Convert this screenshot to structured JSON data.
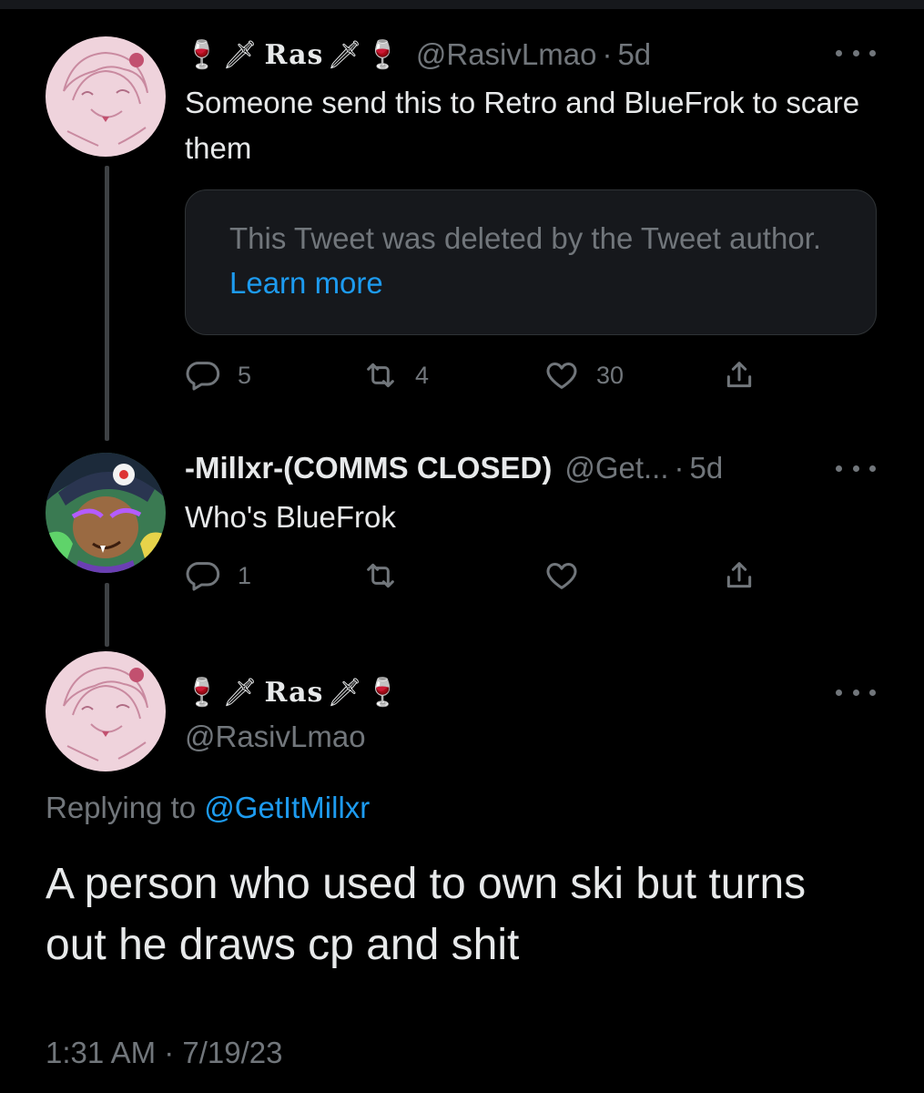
{
  "tweet1": {
    "display_name": "Ras",
    "handle": "@RasivLmao",
    "separator": "·",
    "age": "5d",
    "text": "Someone send this to Retro and BlueFrok to scare them",
    "quoted": {
      "text": "This Tweet was deleted by the Tweet author.",
      "link": "Learn more"
    },
    "actions": {
      "replies": "5",
      "retweets": "4",
      "likes": "30"
    }
  },
  "tweet2": {
    "display_name": "-Millxr-(COMMS CLOSED)",
    "handle": "@Get...",
    "separator": "·",
    "age": "5d",
    "text": "Who's BlueFrok",
    "actions": {
      "replies": "1"
    }
  },
  "main_tweet": {
    "display_name": "Ras",
    "handle": "@RasivLmao",
    "replying_prefix": "Replying to",
    "replying_handle": "@GetItMillxr",
    "text": "A person who used to own ski but turns out he draws cp and shit",
    "timestamp": "1:31 AM · 7/19/23"
  },
  "icons": {
    "wine_glass": "🍷",
    "dagger": "🗡"
  },
  "colors": {
    "background": "#000000",
    "primary_text": "#e7e9ea",
    "secondary_text": "#71767b",
    "link": "#1d9bf0",
    "card_border": "#2f3336"
  }
}
